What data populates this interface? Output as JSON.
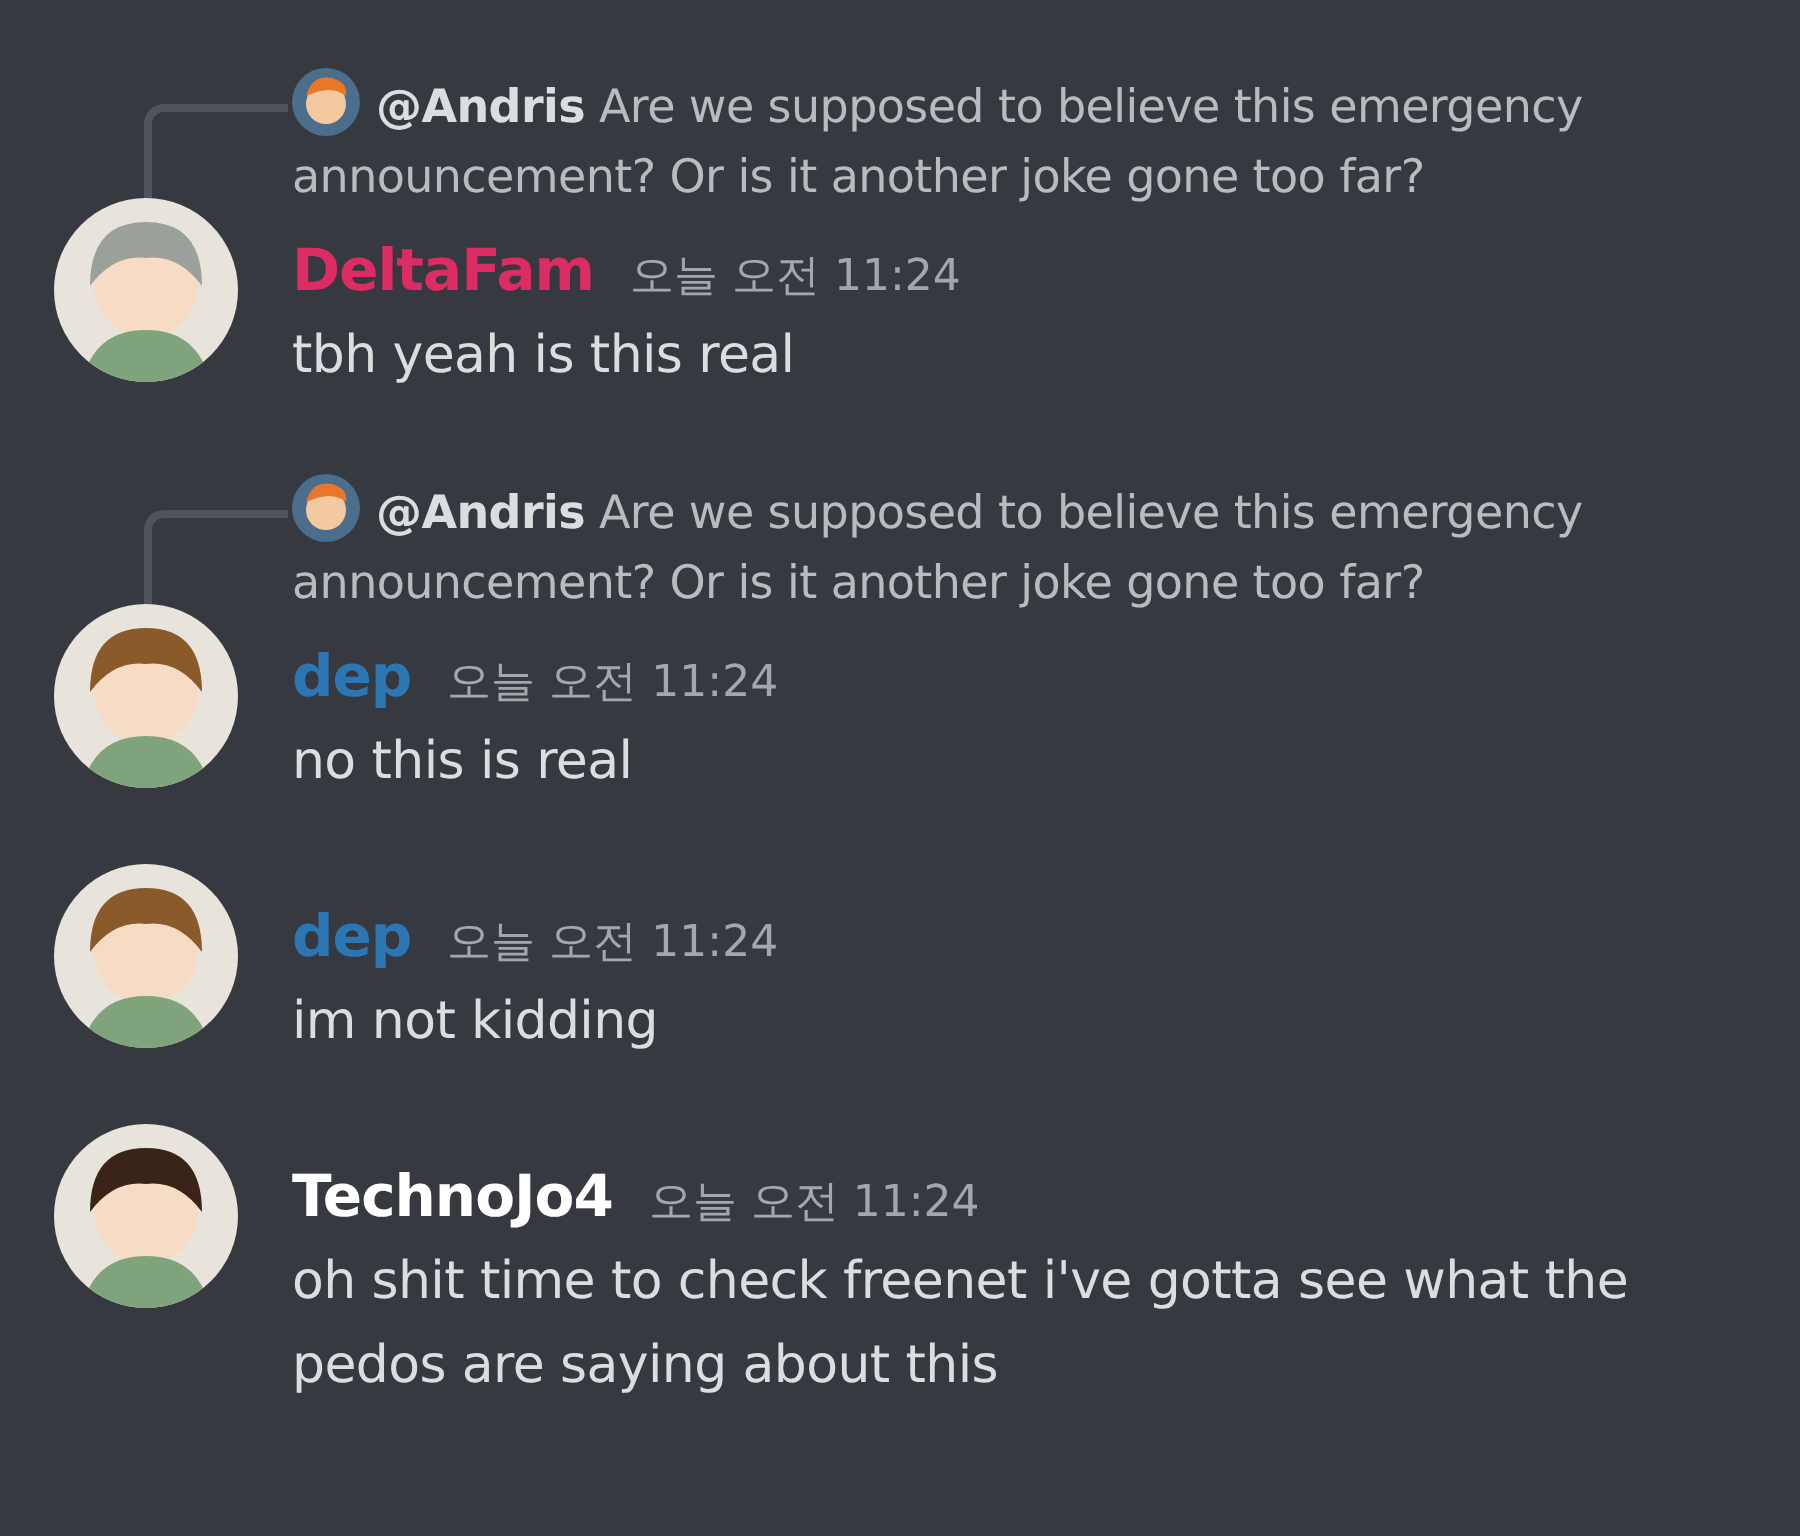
{
  "messages": [
    {
      "reply": {
        "author": "@Andris",
        "text": "Are we supposed to believe this emergency announcement? Or is it another joke gone too far?"
      },
      "author": "DeltaFam",
      "color": "#dd2c63",
      "timestamp": "오늘 오전 11:24",
      "text": "tbh yeah is this real"
    },
    {
      "reply": {
        "author": "@Andris",
        "text": "Are we supposed to believe this emergency announcement? Or is it another joke gone too far?"
      },
      "author": "dep",
      "color": "#2d76b4",
      "timestamp": "오늘 오전 11:24",
      "text": "no this is real"
    },
    {
      "author": "dep",
      "color": "#2d76b4",
      "timestamp": "오늘 오전 11:24",
      "text": "im not kidding"
    },
    {
      "author": "TechnoJo4",
      "color": "#ffffff",
      "timestamp": "오늘 오전 11:24",
      "text": "oh shit time to check freenet i've gotta see what the pedos are saying about this"
    }
  ]
}
